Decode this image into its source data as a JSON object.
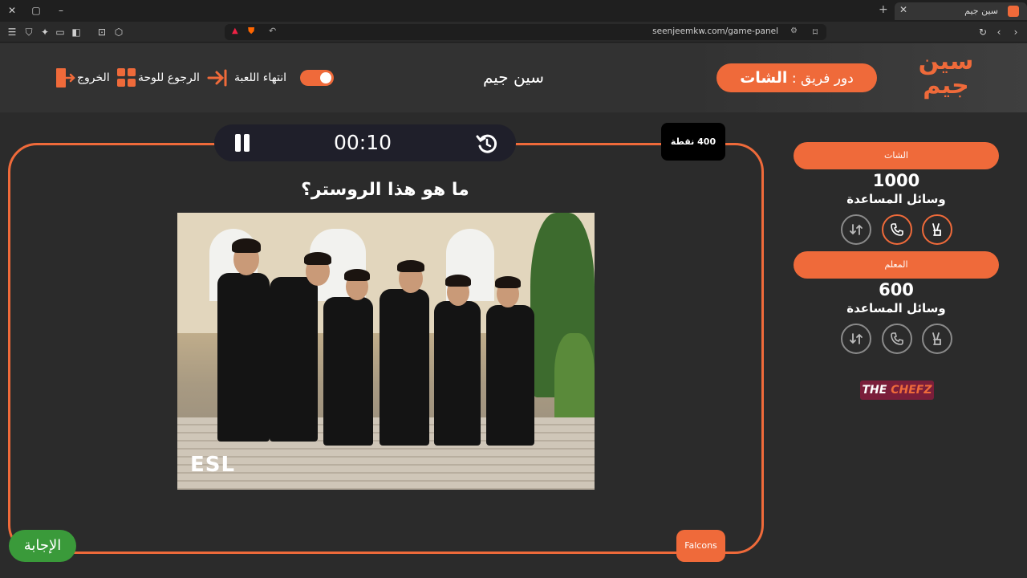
{
  "browser": {
    "tab_title": "سين جيم",
    "url": "seenjeemkw.com/game-panel"
  },
  "header": {
    "logo_text": "سين جيم",
    "turn_label": "دور فريق :",
    "turn_team": "الشات",
    "game_name": "سين جيم",
    "end_game_label": "انتهاء اللعبة",
    "back_to_board_label": "الرجوع للوحة",
    "exit_label": "الخروج"
  },
  "game": {
    "timer": "00:10",
    "points": "400 نقطة",
    "question": "ما هو هذا الروستر؟",
    "image_watermark": "ESL",
    "category_button": "Falcons",
    "answer_button": "الإجابة"
  },
  "teams": [
    {
      "name": "الشات",
      "score": "1000",
      "aids_label": "وسائل المساعدة",
      "aids": [
        {
          "icon": "peace-hand-icon",
          "active": true
        },
        {
          "icon": "phone-icon",
          "active": true
        },
        {
          "icon": "swap-icon",
          "active": false
        }
      ]
    },
    {
      "name": "المعلم",
      "score": "600",
      "aids_label": "وسائل المساعدة",
      "aids": [
        {
          "icon": "peace-hand-icon",
          "active": false
        },
        {
          "icon": "phone-icon",
          "active": false
        },
        {
          "icon": "swap-icon",
          "active": false
        }
      ]
    }
  ],
  "sponsor": {
    "part1": "THE ",
    "part2": "CHEFZ"
  },
  "colors": {
    "accent": "#ef6a3a",
    "answer": "#3a9a3a",
    "background": "#2b2b2b"
  }
}
